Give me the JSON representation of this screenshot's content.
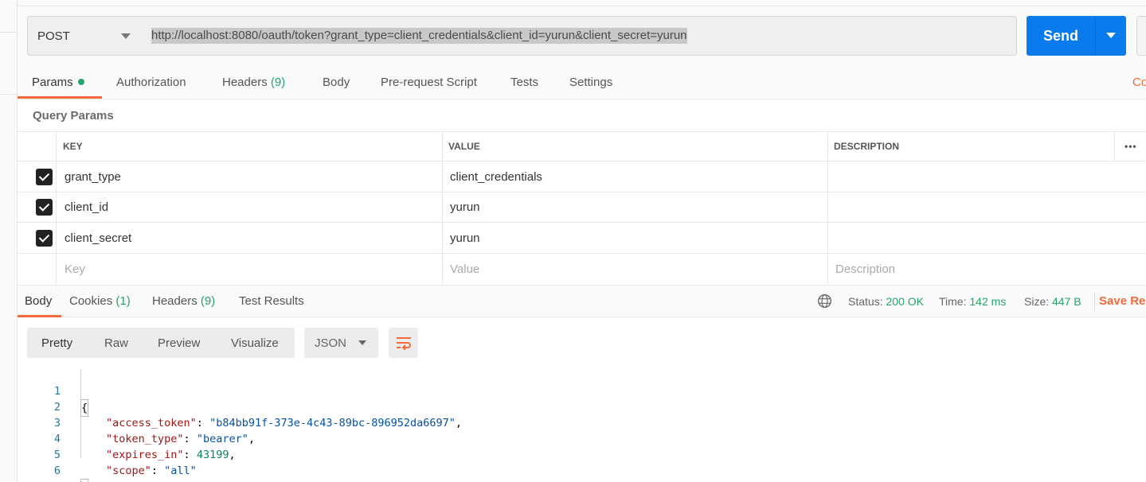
{
  "request": {
    "method": "POST",
    "url": "http://localhost:8080/oauth/token?grant_type=client_credentials&client_id=yurun&client_secret=yurun",
    "send_label": "Send"
  },
  "request_tabs": [
    {
      "label": "Params",
      "active": true,
      "indicator": true
    },
    {
      "label": "Authorization"
    },
    {
      "label": "Headers",
      "count": "(9)"
    },
    {
      "label": "Body"
    },
    {
      "label": "Pre-request Script"
    },
    {
      "label": "Tests"
    },
    {
      "label": "Settings"
    }
  ],
  "cookies_link": "Co",
  "query_params": {
    "title": "Query Params",
    "headers": {
      "key": "KEY",
      "value": "VALUE",
      "description": "DESCRIPTION"
    },
    "more": "•••",
    "rows": [
      {
        "checked": true,
        "key": "grant_type",
        "value": "client_credentials",
        "description": ""
      },
      {
        "checked": true,
        "key": "client_id",
        "value": "yurun",
        "description": ""
      },
      {
        "checked": true,
        "key": "client_secret",
        "value": "yurun",
        "description": ""
      }
    ],
    "placeholders": {
      "key": "Key",
      "value": "Value",
      "description": "Description"
    }
  },
  "response_tabs": [
    {
      "label": "Body",
      "active": true
    },
    {
      "label": "Cookies",
      "count": "(1)"
    },
    {
      "label": "Headers",
      "count": "(9)"
    },
    {
      "label": "Test Results"
    }
  ],
  "response_status": {
    "status_label": "Status:",
    "status_value": "200 OK",
    "time_label": "Time:",
    "time_value": "142 ms",
    "size_label": "Size:",
    "size_value": "447 B",
    "save_label": "Save Re"
  },
  "body_view": {
    "formats": [
      "Pretty",
      "Raw",
      "Preview",
      "Visualize"
    ],
    "active_format": "Pretty",
    "language": "JSON",
    "wrap_icon": "wrap-lines-icon"
  },
  "response_body": {
    "line_numbers": [
      "1",
      "2",
      "3",
      "4",
      "5",
      "6"
    ],
    "open_brace": "{",
    "close_brace": "}",
    "fields": [
      {
        "key": "\"access_token\"",
        "value": "\"b84bb91f-373e-4c43-89bc-896952da6697\"",
        "type": "string",
        "trail": ","
      },
      {
        "key": "\"token_type\"",
        "value": "\"bearer\"",
        "type": "string",
        "trail": ","
      },
      {
        "key": "\"expires_in\"",
        "value": "43199",
        "type": "number",
        "trail": ","
      },
      {
        "key": "\"scope\"",
        "value": "\"all\"",
        "type": "string",
        "trail": ""
      }
    ]
  },
  "colors": {
    "send": "#097bed",
    "accent": "#f26b3a",
    "success": "#26a36b"
  }
}
